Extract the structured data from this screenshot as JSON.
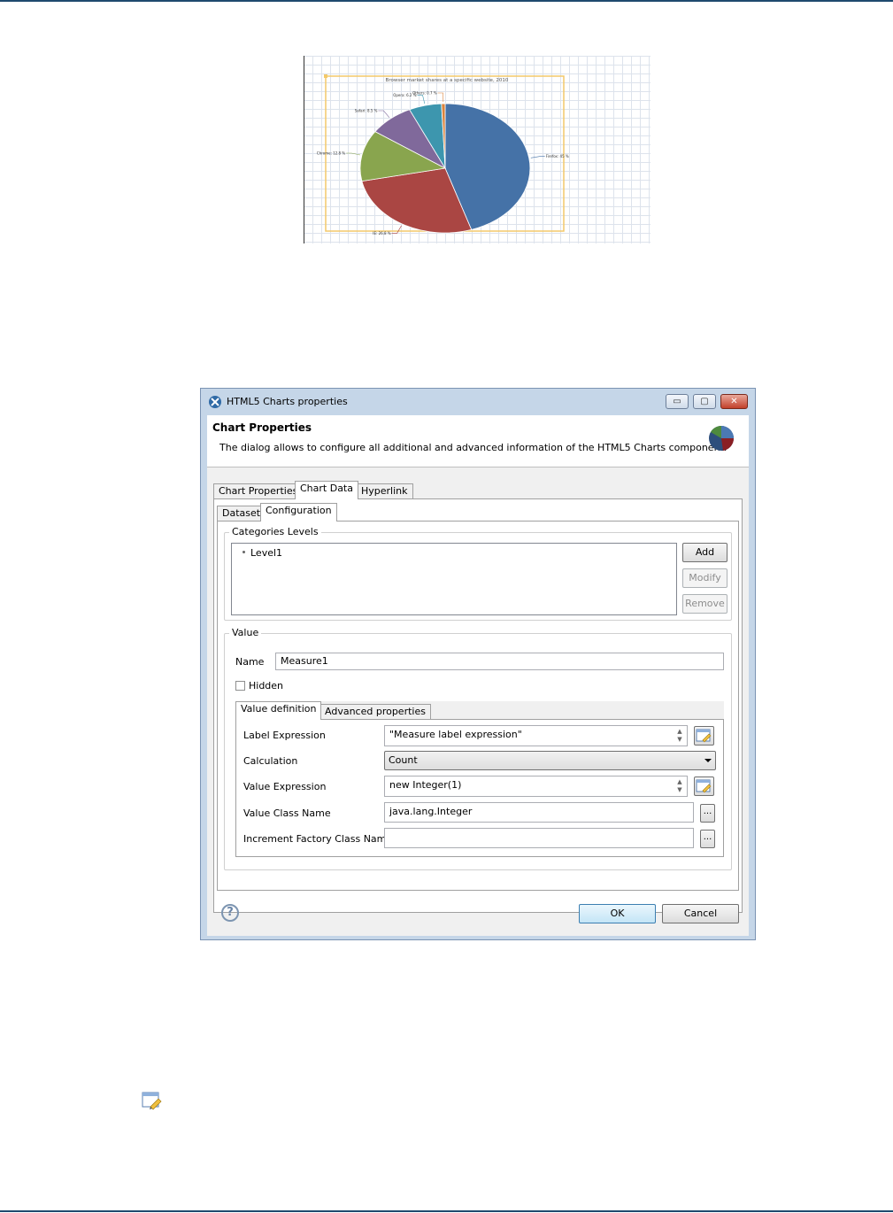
{
  "chart_image": {
    "chart_data": {
      "type": "pie",
      "title": "Browser market shares at a specific website, 2010",
      "categories": [
        "Firefox",
        "IE",
        "Chrome",
        "Safari",
        "Opera",
        "Others"
      ],
      "values": [
        45.0,
        26.8,
        12.8,
        8.5,
        6.2,
        0.7
      ],
      "colors": [
        "#4572a7",
        "#aa4643",
        "#89a54e",
        "#80699b",
        "#3d96ae",
        "#db843d"
      ],
      "labels": [
        "Firefox: 45 %",
        "IE: 26.8 %",
        "Chrome: 12.8 %",
        "Safari: 8.5 %",
        "Opera: 6.2 %",
        "Others: 0.7 %"
      ]
    }
  },
  "dialog": {
    "title": "HTML5 Charts properties",
    "window_buttons": {
      "minimize": "▭",
      "maximize": "▢",
      "close": "✕"
    },
    "header": {
      "heading": "Chart Properties",
      "description": "The dialog allows to configure all additional and advanced information of the HTML5 Charts component."
    },
    "tabs": [
      "Chart Properties",
      "Chart Data",
      "Hyperlink"
    ],
    "subtabs": [
      "Dataset",
      "Configuration"
    ],
    "categories": {
      "label": "Categories Levels",
      "items": [
        "Level1"
      ],
      "buttons": {
        "add": "Add",
        "modify": "Modify",
        "remove": "Remove"
      }
    },
    "value": {
      "label": "Value",
      "name_label": "Name",
      "name_value": "Measure1",
      "hidden_label": "Hidden",
      "tabs": [
        "Value definition",
        "Advanced properties"
      ],
      "fields": {
        "label_expression": {
          "label": "Label Expression",
          "value": "\"Measure label expression\""
        },
        "calculation": {
          "label": "Calculation",
          "value": "Count"
        },
        "value_expression": {
          "label": "Value Expression",
          "value": "new Integer(1)"
        },
        "value_class_name": {
          "label": "Value Class Name",
          "value": "java.lang.Integer"
        },
        "increment_factory": {
          "label": "Increment Factory Class Name",
          "value": ""
        }
      },
      "ellipsis": "..."
    },
    "help": "?",
    "ok": "OK",
    "cancel": "Cancel"
  }
}
